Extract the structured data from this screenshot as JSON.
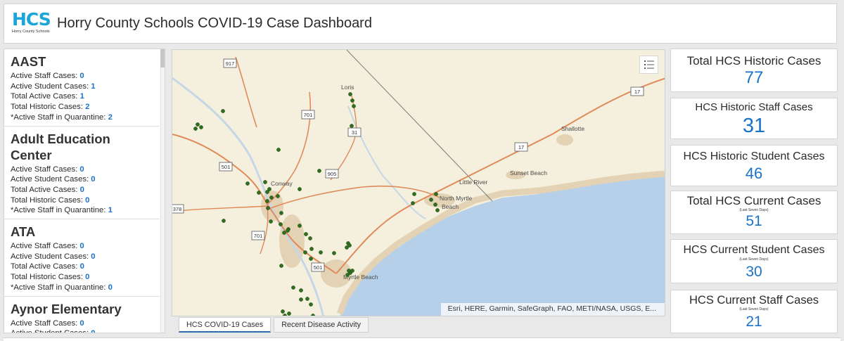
{
  "header": {
    "logo_text": "HCS",
    "logo_sub": "Horry County Schools",
    "title": "Horry County Schools COVID-19 Case Dashboard"
  },
  "schools": [
    {
      "name": "AAST",
      "rows": [
        {
          "label": "Active Staff Cases:",
          "value": "0"
        },
        {
          "label": "Active Student Cases:",
          "value": "1"
        },
        {
          "label": "Total Active Cases:",
          "value": "1"
        },
        {
          "label": "Total Historic Cases:",
          "value": "2"
        },
        {
          "label": "*Active Staff in Quarantine:",
          "value": "2"
        }
      ]
    },
    {
      "name": "Adult Education Center",
      "rows": [
        {
          "label": "Active Staff Cases:",
          "value": "0"
        },
        {
          "label": "Active Student Cases:",
          "value": "0"
        },
        {
          "label": "Total Active Cases:",
          "value": "0"
        },
        {
          "label": "Total Historic Cases:",
          "value": "0"
        },
        {
          "label": "*Active Staff in Quarantine:",
          "value": "1"
        }
      ]
    },
    {
      "name": "ATA",
      "rows": [
        {
          "label": "Active Staff Cases:",
          "value": "0"
        },
        {
          "label": "Active Student Cases:",
          "value": "0"
        },
        {
          "label": "Total Active Cases:",
          "value": "0"
        },
        {
          "label": "Total Historic Cases:",
          "value": "0"
        },
        {
          "label": "*Active Staff in Quarantine:",
          "value": "0"
        }
      ]
    },
    {
      "name": "Aynor Elementary",
      "rows": [
        {
          "label": "Active Staff Cases:",
          "value": "0"
        },
        {
          "label": "Active Student Cases:",
          "value": "0"
        }
      ]
    }
  ],
  "map": {
    "places": [
      "Loris",
      "Shallotte",
      "Sunset Beach",
      "Little River",
      "North Myrtle",
      "Beach",
      "Conway",
      "Myrtle Beach"
    ],
    "routes": [
      "917",
      "17",
      "701",
      "31",
      "17",
      "501",
      "905",
      "378",
      "701",
      "501"
    ],
    "attribution": "Esri, HERE, Garmin, SafeGraph, FAO, METI/NASA, USGS, E...",
    "layer_icon": "layer-list-icon",
    "colors": {
      "land": "#f4f0dd",
      "water": "#b5d0e8",
      "road": "#e08a5a",
      "urban": "#e3d3b4",
      "marker": "#2f6f1f"
    }
  },
  "tabs": [
    {
      "label": "HCS COVID-19 Cases",
      "active": true
    },
    {
      "label": "Recent Disease Activity",
      "active": false
    }
  ],
  "indicators": [
    {
      "title": "Total HCS Historic Cases",
      "sub": "",
      "value": "77"
    },
    {
      "title": "HCS Historic Staff Cases",
      "sub": "",
      "value": "31"
    },
    {
      "title": "HCS Historic Student Cases",
      "sub": "",
      "value": "46"
    },
    {
      "title": "Total HCS Current Cases",
      "sub": "(Last Seven Days)",
      "value": "51"
    },
    {
      "title": "HCS Current Student Cases",
      "sub": "(Last Seven Days)",
      "value": "30"
    },
    {
      "title": "HCS Current Staff Cases",
      "sub": "(Last Seven Days)",
      "value": "21"
    }
  ],
  "theme": {
    "accent": "#1a73c8",
    "logo": "#1aa6d9"
  }
}
